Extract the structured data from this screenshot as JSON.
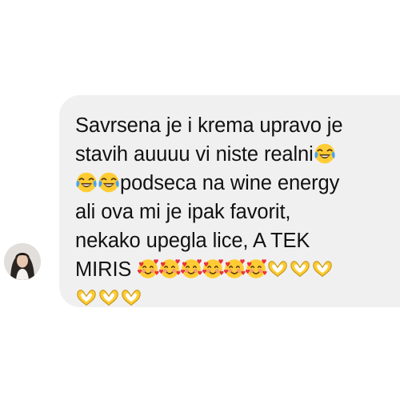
{
  "message": {
    "lines": [
      "Savrsena je i krema upravo je",
      "stavih auuuu vi niste realni",
      "podseca na wine energy",
      "ali ova mi je ipak favorit,",
      "nekako upegla lice, A TEK",
      "MIRIS"
    ]
  },
  "emoji": {
    "laughing": "face-with-tears-of-joy-emoji",
    "hearts": "smiling-face-with-hearts-emoji",
    "heart_hands": "heart-hands-emoji"
  },
  "colors": {
    "bubble": "#f0f0f0",
    "text": "#111111",
    "emoji_yellow": "#ffcc33",
    "heart_red": "#e8323c"
  }
}
